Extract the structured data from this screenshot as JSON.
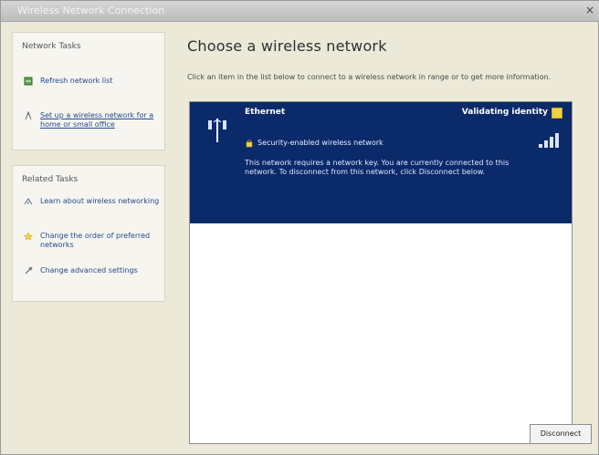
{
  "window": {
    "title": "Wireless Network Connection"
  },
  "sidebar": {
    "network_tasks": {
      "title": "Network Tasks",
      "items": [
        {
          "label": "Refresh network list",
          "icon": "refresh-icon"
        },
        {
          "label": "Set up a wireless network for a home or small office",
          "icon": "setup-icon"
        }
      ]
    },
    "related_tasks": {
      "title": "Related Tasks",
      "items": [
        {
          "label": "Learn about wireless networking",
          "icon": "info-icon"
        },
        {
          "label": "Change the order of preferred networks",
          "icon": "star-icon"
        },
        {
          "label": "Change advanced settings",
          "icon": "settings-icon"
        }
      ]
    }
  },
  "main": {
    "heading": "Choose a wireless network",
    "description": "Click an item in the list below to connect to a wireless network in range or to get more information.",
    "networks": [
      {
        "ssid": "Ethernet",
        "status": "Validating identity",
        "security": "Security-enabled wireless network",
        "note": "This network requires a network key. You are currently connected to this network. To disconnect from this network, click Disconnect below."
      }
    ],
    "disconnect_label": "Disconnect"
  },
  "colors": {
    "selection": "#0a2a6a",
    "link": "#254a8f",
    "window_bg": "#ece9d8"
  }
}
